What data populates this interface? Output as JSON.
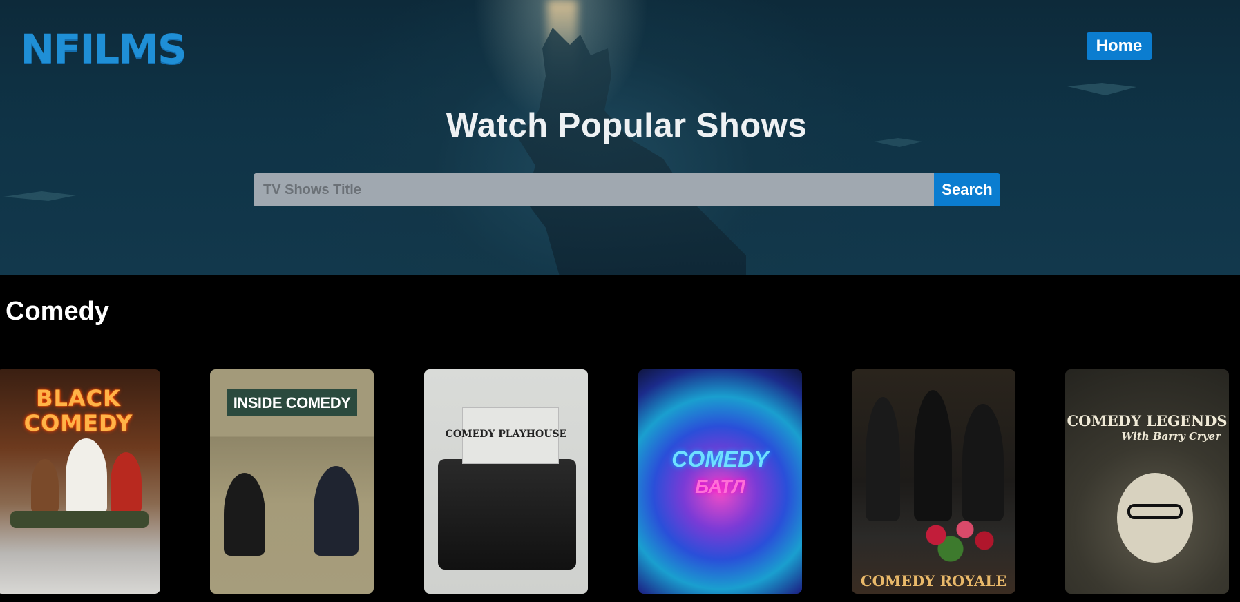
{
  "brand": {
    "logo_text": "NFILMS",
    "accent_color": "#0b7dd0",
    "logo_color": "#1f8fd6"
  },
  "nav": {
    "home_label": "Home"
  },
  "hero": {
    "title": "Watch Popular Shows",
    "search": {
      "placeholder": "TV Shows Title",
      "value": "",
      "button_label": "Search"
    }
  },
  "section": {
    "title": "Comedy",
    "posters": [
      {
        "title_line1": "BLACK",
        "title_line2": "COMEDY"
      },
      {
        "title": "INSIDE COMEDY"
      },
      {
        "title": "COMEDY PLAYHOUSE"
      },
      {
        "title_line1": "COMEDY",
        "title_line2": "БАТЛ"
      },
      {
        "title": "COMEDY ROYALE"
      },
      {
        "title": "COMEDY LEGENDS",
        "subtitle": "With Barry Cryer"
      }
    ]
  }
}
